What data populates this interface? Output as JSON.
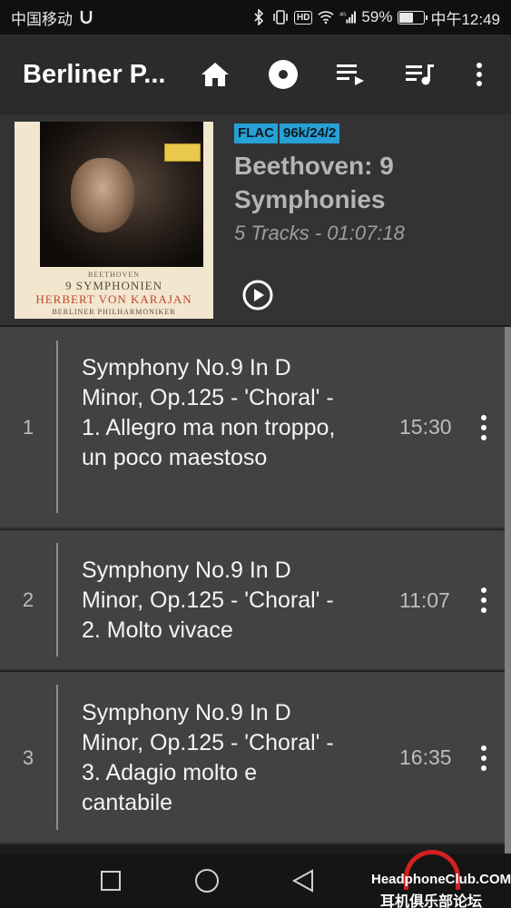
{
  "status_bar": {
    "carrier": "中国移动",
    "carrier_icon": "usb-debug-icon",
    "network": "4G",
    "battery_percent": "59%",
    "battery_level": 0.59,
    "time": "中午12:49",
    "hd_label": "HD"
  },
  "app_bar": {
    "title": "Berliner P...",
    "icons": [
      "home-icon",
      "disc-icon",
      "queue-play-icon",
      "playlist-music-icon",
      "more-vert-icon"
    ]
  },
  "album": {
    "format_badge": "FLAC",
    "quality_badge": "96k/24/2",
    "title": "Beethoven: 9 Symphonies",
    "meta": "5 Tracks - 01:07:18",
    "cover": {
      "line1": "BEETHOVEN",
      "line2": "9 SYMPHONIEN",
      "line3": "HERBERT VON KARAJAN",
      "line4": "BERLINER PHILHARMONIKER"
    }
  },
  "tracks": [
    {
      "number": "1",
      "title": "Symphony No.9 In D Minor, Op.125 - 'Choral' - 1. Allegro ma non troppo, un poco maestoso",
      "duration": "15:30"
    },
    {
      "number": "2",
      "title": "Symphony No.9 In D Minor, Op.125 - 'Choral' - 2. Molto vivace",
      "duration": "11:07"
    },
    {
      "number": "3",
      "title": "Symphony No.9 In D Minor, Op.125 - 'Choral' - 3. Adagio molto e cantabile",
      "duration": "16:35"
    }
  ],
  "nav_bar": {
    "icons": [
      "recents-square-icon",
      "home-circle-icon",
      "back-triangle-icon"
    ]
  },
  "watermark": {
    "top": "HeadphoneClub.COM",
    "bottom": "耳机俱乐部论坛"
  },
  "colors": {
    "accent_badge": "#27a0d6",
    "track_bg": "#424242",
    "header_bg": "#333333",
    "appbar_bg": "#2b2b2b"
  }
}
